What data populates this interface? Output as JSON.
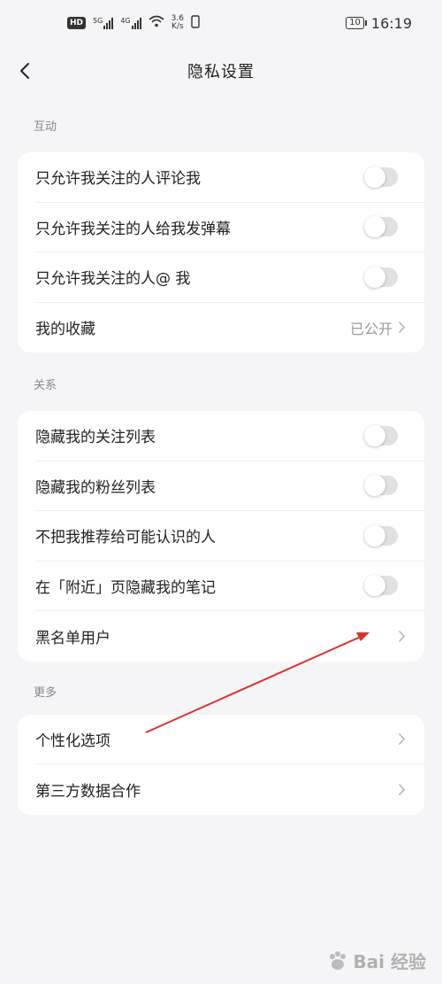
{
  "status_bar": {
    "hd": "HD",
    "sim1": "5G",
    "sim2": "4G",
    "speed_value": "3.6",
    "speed_unit": "K/s",
    "battery": "10",
    "time": "16:19"
  },
  "nav": {
    "title": "隐私设置"
  },
  "sections": {
    "interaction": {
      "label": "互动",
      "rows": [
        {
          "label": "只允许我关注的人评论我",
          "toggle_on": false
        },
        {
          "label": "只允许我关注的人给我发弹幕",
          "toggle_on": false
        },
        {
          "label": "只允许我关注的人@ 我",
          "toggle_on": false
        },
        {
          "label": "我的收藏",
          "value": "已公开"
        }
      ]
    },
    "relations": {
      "label": "关系",
      "rows": [
        {
          "label": "隐藏我的关注列表",
          "toggle_on": false
        },
        {
          "label": "隐藏我的粉丝列表",
          "toggle_on": false
        },
        {
          "label": "不把我推荐给可能认识的人",
          "toggle_on": false
        },
        {
          "label": "在「附近」页隐藏我的笔记",
          "toggle_on": false
        },
        {
          "label": "黑名单用户"
        }
      ]
    },
    "more": {
      "label": "更多",
      "rows": [
        {
          "label": "个性化选项"
        },
        {
          "label": "第三方数据合作"
        }
      ]
    }
  },
  "watermark": {
    "text": "Bai 经验"
  },
  "colors": {
    "toggle_off": "#e1e1e3",
    "annotation_arrow": "#d9342b",
    "background": "#f5f5f7"
  }
}
